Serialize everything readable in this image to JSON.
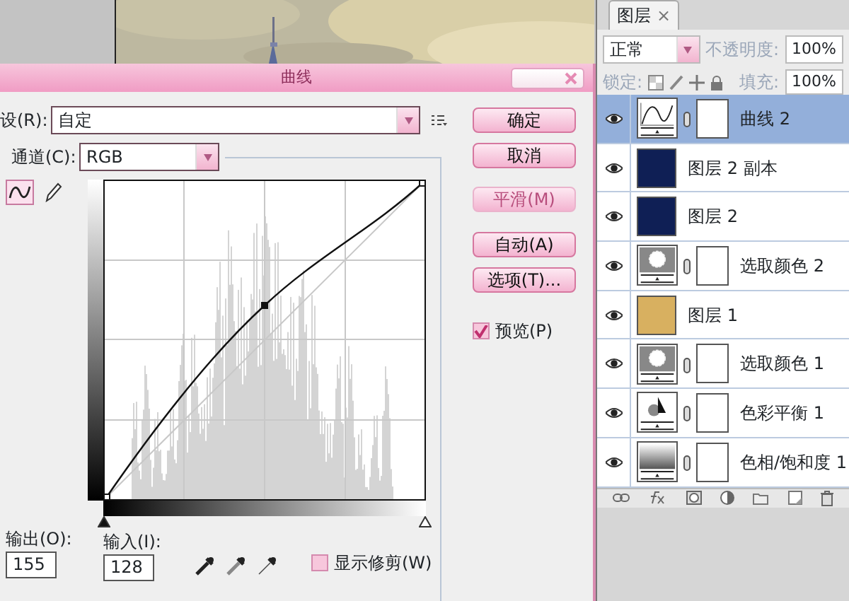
{
  "curves_dialog": {
    "title": "曲线",
    "preset": {
      "label": "设(R):",
      "value": "自定"
    },
    "channel": {
      "label": "通道(C):",
      "value": "RGB"
    },
    "tools": [
      {
        "kind": "curve",
        "selected": true
      },
      {
        "kind": "pencil",
        "selected": false
      }
    ],
    "input_sliders": [
      {
        "kind": "black_point",
        "level": 0
      },
      {
        "kind": "white_point",
        "level": 1
      }
    ],
    "output": {
      "label": "输出(O):",
      "value": "155"
    },
    "input": {
      "label": "输入(I):",
      "value": "128"
    },
    "show_clipping": {
      "label": "显示修剪(W)",
      "checked": false
    },
    "buttons": [
      {
        "label": "确定",
        "disabled": false
      },
      {
        "label": "取消",
        "disabled": false
      },
      {
        "label": "平滑(M)",
        "disabled": true
      },
      {
        "label": "自动(A)",
        "disabled": false
      },
      {
        "label": "选项(T)...",
        "disabled": false
      }
    ],
    "preview": {
      "label": "预览(P)",
      "checked": true
    }
  },
  "layers_panel": {
    "tab": {
      "label": "图层",
      "close": "×"
    },
    "blend_mode": "正常",
    "opacity": {
      "label": "不透明度:",
      "value": "100%"
    },
    "lock_label": "锁定:",
    "fill": {
      "label": "填充:",
      "value": "100%"
    },
    "layers": [
      {
        "name": "曲线 2",
        "kind": "curves",
        "visible": true,
        "selected": true
      },
      {
        "name": "图层 2 副本",
        "kind": "pixel",
        "color": "#0f1f55",
        "visible": true,
        "selected": false
      },
      {
        "name": "图层 2",
        "kind": "pixel",
        "color": "#0f1f55",
        "visible": true,
        "selected": false
      },
      {
        "name": "选取颜色 2",
        "kind": "selective_color",
        "visible": true,
        "selected": false
      },
      {
        "name": "图层 1",
        "kind": "pixel",
        "color": "#d8b060",
        "visible": true,
        "selected": false
      },
      {
        "name": "选取颜色 1",
        "kind": "selective_color",
        "visible": true,
        "selected": false
      },
      {
        "name": "色彩平衡 1",
        "kind": "color_balance",
        "visible": true,
        "selected": false
      },
      {
        "name": "色相/饱和度 1",
        "kind": "hue_saturation",
        "visible": true,
        "selected": false
      }
    ]
  }
}
